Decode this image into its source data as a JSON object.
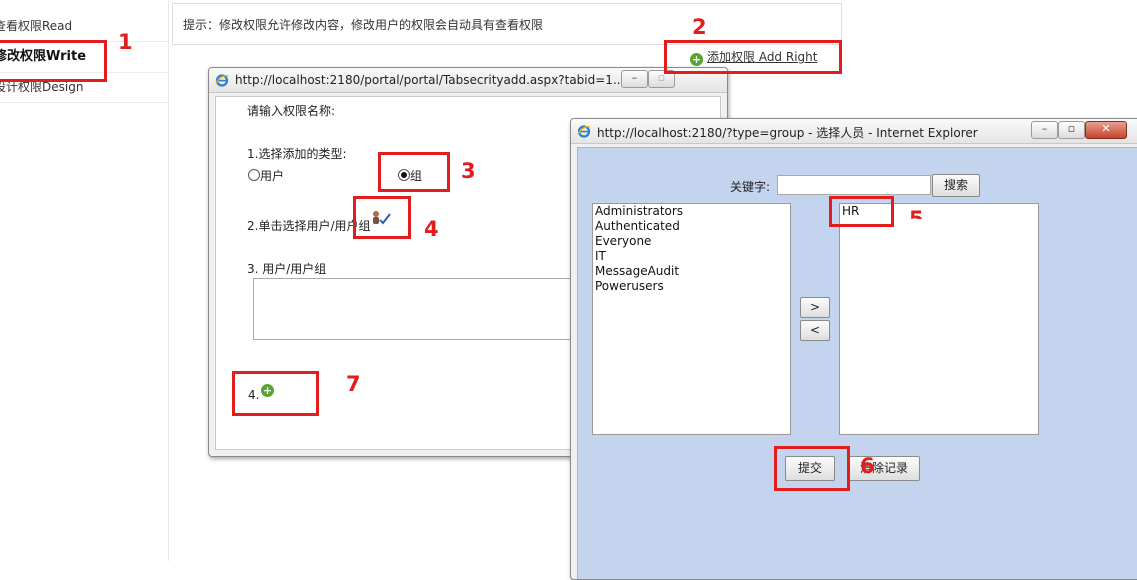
{
  "sidebar": {
    "items": [
      {
        "label": "查看权限Read"
      },
      {
        "label": "修改权限Write"
      },
      {
        "label": "设计权限Design"
      }
    ]
  },
  "hint": {
    "text": "提示：修改权限允许修改内容，修改用户的权限会自动具有查看权限"
  },
  "add_right": {
    "label": "添加权限  Add Right"
  },
  "window1": {
    "title": "http://localhost:2180/portal/portal/Tabsecrityadd.aspx?tabid=1...",
    "name_label": "请输入权限名称:",
    "type_label": "1.选择添加的类型:",
    "option_user": "用户",
    "option_group": "组",
    "select_label": "2.单击选择用户/用户组",
    "users_label": "3. 用户/用户组",
    "add_label": "4."
  },
  "window2": {
    "title": "http://localhost:2180/?type=group - 选择人员 - Internet Explorer",
    "keyword_label": "关键字:",
    "search_button": "搜索",
    "left_list": [
      "Administrators",
      "Authenticated",
      "Everyone",
      "IT",
      "MessageAudit",
      "Powerusers"
    ],
    "right_list": [
      "HR"
    ],
    "move_right": ">",
    "move_left": "<",
    "submit_button": "提交",
    "clear_button": "清除记录"
  },
  "annotations": [
    "1",
    "2",
    "3",
    "4",
    "5",
    "6",
    "7"
  ],
  "colors": {
    "annotation": "#e11d1d",
    "dialog_bg": "#c4d4ef",
    "plus": "#55a630"
  }
}
